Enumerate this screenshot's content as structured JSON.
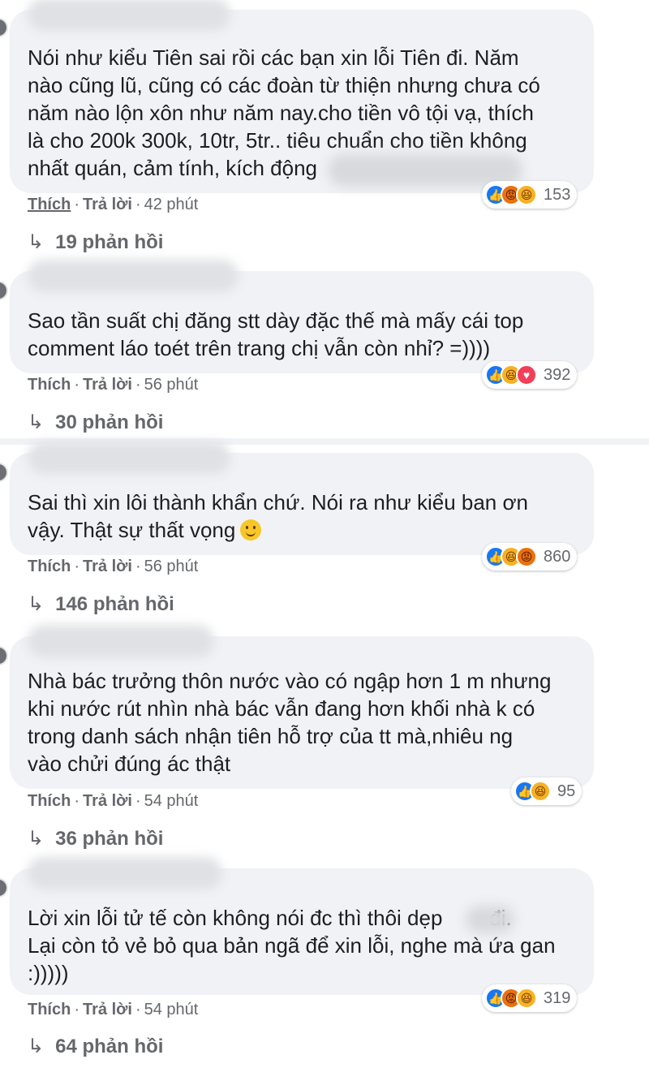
{
  "comments": [
    {
      "text": "Nói như kiểu Tiên sai rồi các bạn xin lỗi Tiên đi. Năm\nnào cũng lũ, cũng có các đoàn từ thiện nhưng chưa có\nnăm nào lộn xôn như năm nay.cho tiền vô tội vạ, thích\nlà cho 200k 300k, 10tr, 5tr.. tiêu chuẩn cho tiền không\nnhất quán, cảm tính, kích động",
      "like": "Thích",
      "reply": "Trả lời",
      "time": "42 phút",
      "reaction_icons": [
        "like-icon",
        "angry-icon",
        "haha-icon"
      ],
      "reaction_count": "153",
      "replies": "19 phản hồi"
    },
    {
      "text": "Sao tần suất chị đăng stt dày đặc thế mà mấy cái top\ncomment láo toét trên trang chị vẫn còn nhỉ? =))))",
      "like": "Thích",
      "reply": "Trả lời",
      "time": "56 phút",
      "reaction_icons": [
        "like-icon",
        "haha-icon",
        "love-icon"
      ],
      "reaction_count": "392",
      "replies": "30 phản hồi"
    },
    {
      "text": "Sai thì xin lôi thành khẩn chứ. Nói ra như kiểu ban ơn\nvậy. Thật sự thất vọng",
      "like": "Thích",
      "reply": "Trả lời",
      "time": "56 phút",
      "reaction_icons": [
        "like-icon",
        "haha-icon",
        "angry-icon"
      ],
      "reaction_count": "860",
      "replies": "146 phản hồi"
    },
    {
      "text": "Nhà bác trưởng thôn nước vào có ngập hơn 1 m nhưng\nkhi nước rút nhìn nhà bác vẫn đang hơn khối nhà k có\ntrong danh sách nhận tiên hỗ trợ của tt mà,nhiêu ng\nvào chửi đúng ác thật",
      "like": "Thích",
      "reply": "Trả lời",
      "time": "54 phút",
      "reaction_icons": [
        "like-icon",
        "haha-icon"
      ],
      "reaction_count": "95",
      "replies": "36 phản hồi"
    },
    {
      "text": "Lời xin lỗi tử tế còn không nói đc thì thôi dẹp        đi.\nLại còn tỏ vẻ bỏ qua bản ngã để xin lỗi, nghe mà ứa gan\n:)))))",
      "like": "Thích",
      "reply": "Trả lời",
      "time": "54 phút",
      "reaction_icons": [
        "like-icon",
        "angry-icon",
        "haha-icon"
      ],
      "reaction_count": "319",
      "replies": "64 phản hồi"
    }
  ],
  "colors": {
    "bubble": "#f0f2f5",
    "meta_text": "#65676b",
    "like_blue": "#1877f2",
    "haha_yellow": "#f7b125",
    "angry_orange": "#e9710f",
    "love_red": "#f33e58"
  }
}
